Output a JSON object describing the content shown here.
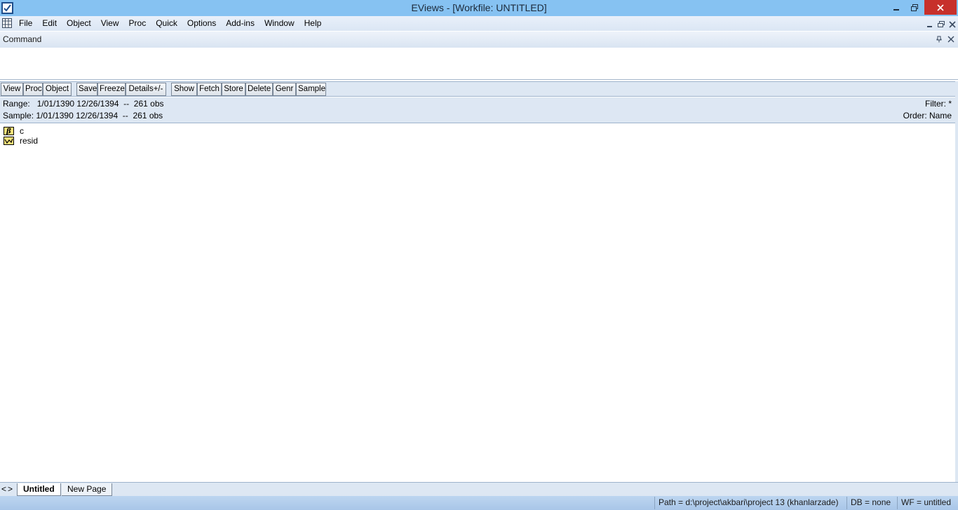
{
  "window": {
    "title": "EViews - [Workfile: UNTITLED]"
  },
  "menu": {
    "items": [
      "File",
      "Edit",
      "Object",
      "View",
      "Proc",
      "Quick",
      "Options",
      "Add-ins",
      "Window",
      "Help"
    ]
  },
  "command": {
    "title": "Command",
    "value": ""
  },
  "toolbar": {
    "view": "View",
    "proc": "Proc",
    "object": "Object",
    "save": "Save",
    "freeze": "Freeze",
    "details": "Details+/-",
    "show": "Show",
    "fetch": "Fetch",
    "store": "Store",
    "delete": "Delete",
    "genr": "Genr",
    "sample": "Sample"
  },
  "info": {
    "range": "Range:   1/01/1390 12/26/1394  --  261 obs",
    "sample": "Sample: 1/01/1390 12/26/1394  --  261 obs",
    "filter": "Filter: *",
    "order": "Order: Name"
  },
  "objects": [
    {
      "name": "c",
      "icon": "coefficient-vector-icon"
    },
    {
      "name": "resid",
      "icon": "series-icon"
    }
  ],
  "tabs": {
    "arrows": "<>",
    "active": "Untitled",
    "new_page": "New Page"
  },
  "status": {
    "path": "Path = d:\\project\\akbari\\project 13 (khanlarzade)",
    "db": "DB = none",
    "wf": "WF = untitled"
  },
  "colors": {
    "titlebar": "#86c2f2",
    "close_button": "#c7302b",
    "panel": "#dde7f3",
    "statusbar": "#a9c6e8"
  }
}
